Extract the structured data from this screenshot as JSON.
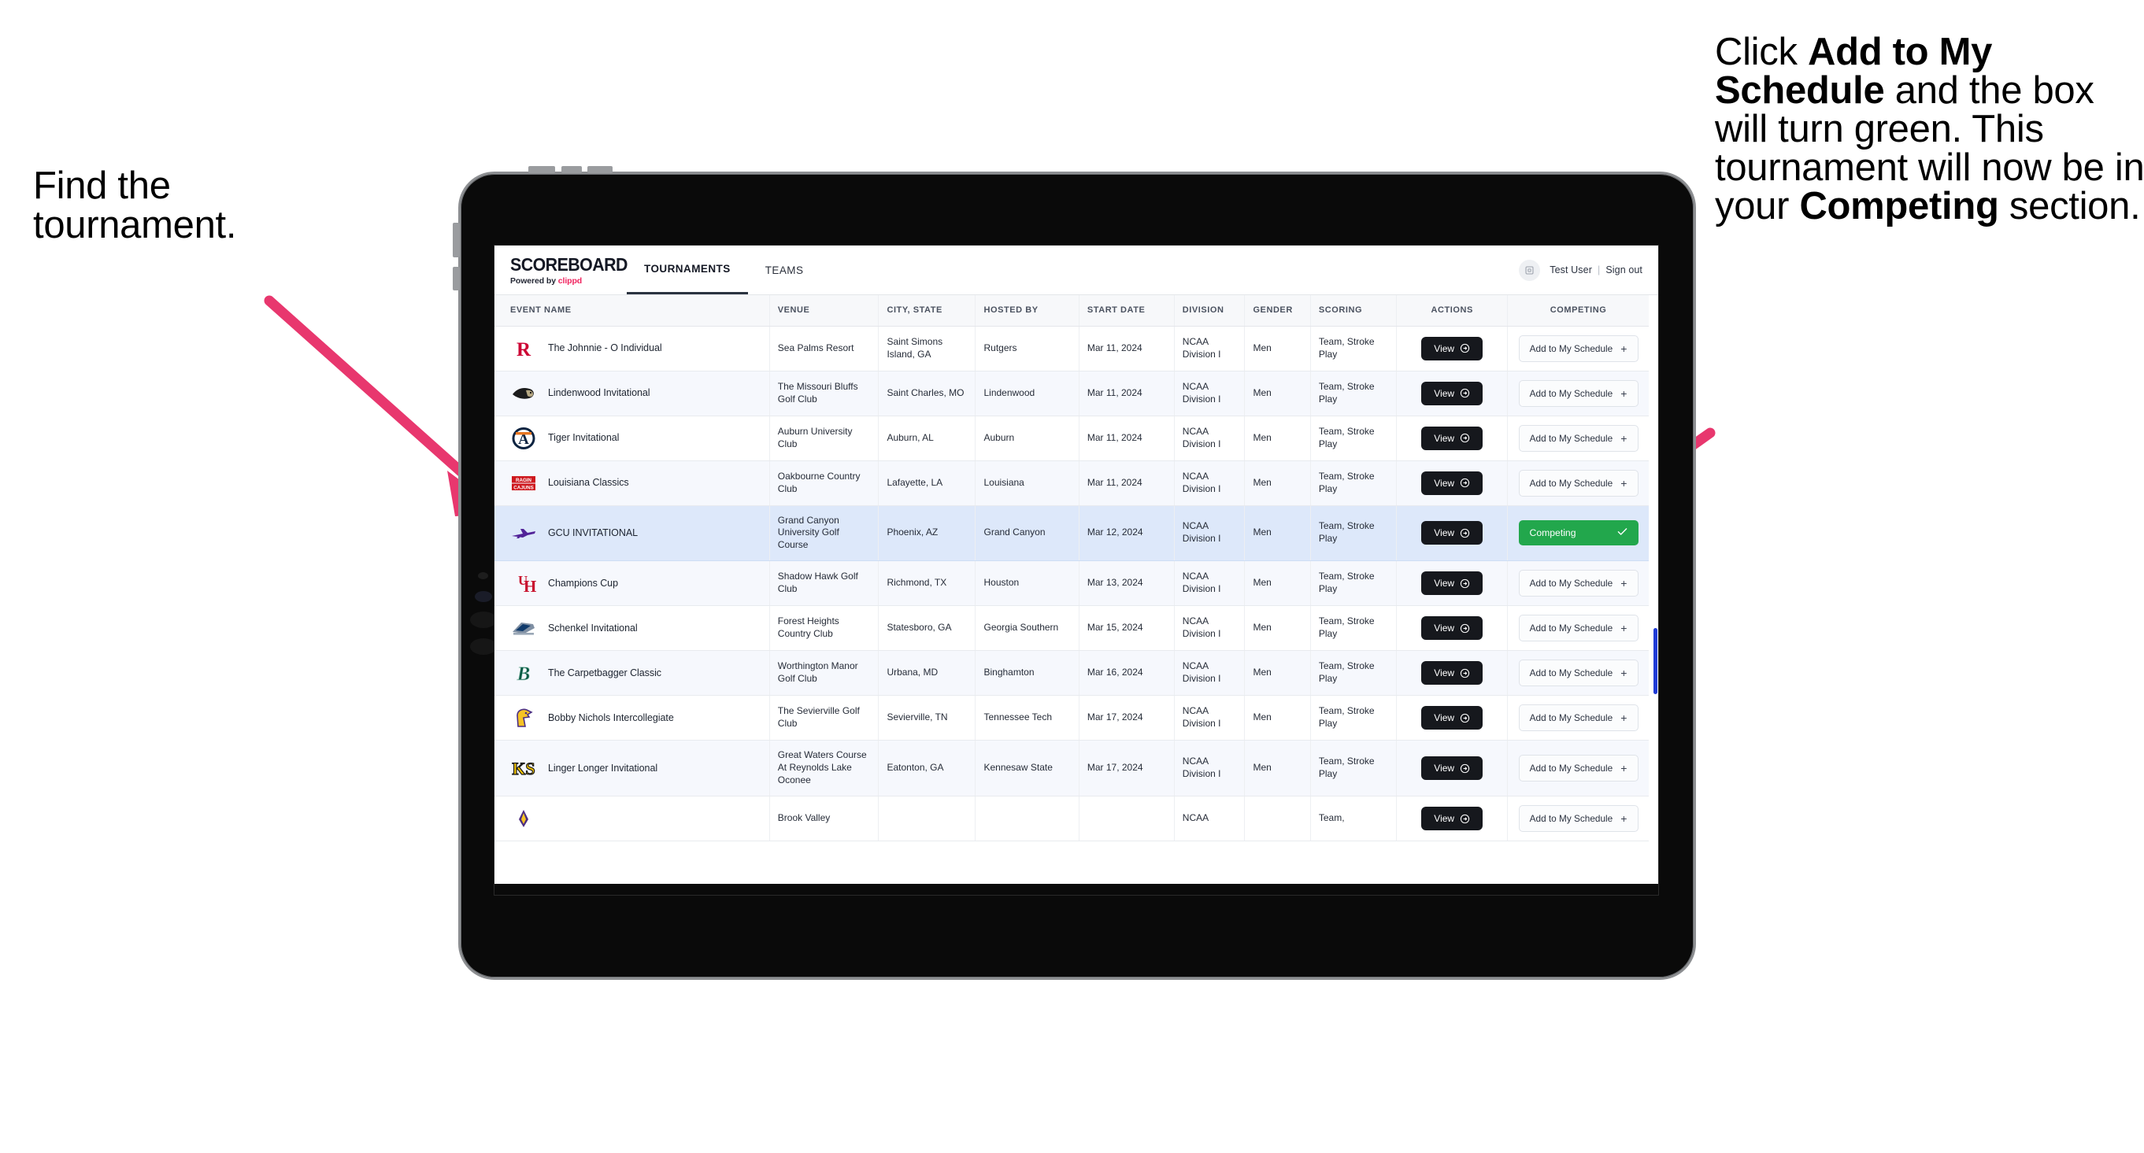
{
  "annotations": {
    "left": "Find the tournament.",
    "right_parts": [
      {
        "text": "Click ",
        "bold": false
      },
      {
        "text": "Add to My Schedule",
        "bold": true
      },
      {
        "text": " and the box will turn green. This tournament will now be in your ",
        "bold": false
      },
      {
        "text": "Competing",
        "bold": true
      },
      {
        "text": " section.",
        "bold": false
      }
    ],
    "arrow_color": "#e8376e"
  },
  "app": {
    "logo": {
      "wordmark": "SCOREBOARD",
      "powered_prefix": "Powered by ",
      "powered_brand": "clippd"
    },
    "nav": [
      {
        "label": "TOURNAMENTS",
        "active": true
      },
      {
        "label": "TEAMS",
        "active": false
      }
    ],
    "user": {
      "avatar_icon": "user-avatar-icon",
      "name": "Test User",
      "separator": "|",
      "signout": "Sign out"
    }
  },
  "table": {
    "columns": [
      "EVENT NAME",
      "VENUE",
      "CITY, STATE",
      "HOSTED BY",
      "START DATE",
      "DIVISION",
      "GENDER",
      "SCORING",
      "ACTIONS",
      "COMPETING"
    ],
    "action_label": "View",
    "add_label": "Add to My Schedule",
    "add_plus": "+",
    "competing_label": "Competing",
    "competing_check": "✓",
    "rows": [
      {
        "logo": "rutgers-logo",
        "event": "The Johnnie - O Individual",
        "venue": "Sea Palms Resort",
        "city": "Saint Simons Island, GA",
        "host": "Rutgers",
        "date": "Mar 11, 2024",
        "division": "NCAA Division I",
        "gender": "Men",
        "scoring": "Team, Stroke Play",
        "competing": false
      },
      {
        "logo": "lindenwood-logo",
        "event": "Lindenwood Invitational",
        "venue": "The Missouri Bluffs Golf Club",
        "city": "Saint Charles, MO",
        "host": "Lindenwood",
        "date": "Mar 11, 2024",
        "division": "NCAA Division I",
        "gender": "Men",
        "scoring": "Team, Stroke Play",
        "competing": false
      },
      {
        "logo": "auburn-logo",
        "event": "Tiger Invitational",
        "venue": "Auburn University Club",
        "city": "Auburn, AL",
        "host": "Auburn",
        "date": "Mar 11, 2024",
        "division": "NCAA Division I",
        "gender": "Men",
        "scoring": "Team, Stroke Play",
        "competing": false
      },
      {
        "logo": "louisiana-logo",
        "event": "Louisiana Classics",
        "venue": "Oakbourne Country Club",
        "city": "Lafayette, LA",
        "host": "Louisiana",
        "date": "Mar 11, 2024",
        "division": "NCAA Division I",
        "gender": "Men",
        "scoring": "Team, Stroke Play",
        "competing": false
      },
      {
        "logo": "gcu-logo",
        "event": "GCU INVITATIONAL",
        "venue": "Grand Canyon University Golf Course",
        "city": "Phoenix, AZ",
        "host": "Grand Canyon",
        "date": "Mar 12, 2024",
        "division": "NCAA Division I",
        "gender": "Men",
        "scoring": "Team, Stroke Play",
        "competing": true
      },
      {
        "logo": "houston-logo",
        "event": "Champions Cup",
        "venue": "Shadow Hawk Golf Club",
        "city": "Richmond, TX",
        "host": "Houston",
        "date": "Mar 13, 2024",
        "division": "NCAA Division I",
        "gender": "Men",
        "scoring": "Team, Stroke Play",
        "competing": false
      },
      {
        "logo": "georgia-southern-logo",
        "event": "Schenkel Invitational",
        "venue": "Forest Heights Country Club",
        "city": "Statesboro, GA",
        "host": "Georgia Southern",
        "date": "Mar 15, 2024",
        "division": "NCAA Division I",
        "gender": "Men",
        "scoring": "Team, Stroke Play",
        "competing": false
      },
      {
        "logo": "binghamton-logo",
        "event": "The Carpetbagger Classic",
        "venue": "Worthington Manor Golf Club",
        "city": "Urbana, MD",
        "host": "Binghamton",
        "date": "Mar 16, 2024",
        "division": "NCAA Division I",
        "gender": "Men",
        "scoring": "Team, Stroke Play",
        "competing": false
      },
      {
        "logo": "tennessee-tech-logo",
        "event": "Bobby Nichols Intercollegiate",
        "venue": "The Sevierville Golf Club",
        "city": "Sevierville, TN",
        "host": "Tennessee Tech",
        "date": "Mar 17, 2024",
        "division": "NCAA Division I",
        "gender": "Men",
        "scoring": "Team, Stroke Play",
        "competing": false
      },
      {
        "logo": "kennesaw-state-logo",
        "event": "Linger Longer Invitational",
        "venue": "Great Waters Course At Reynolds Lake Oconee",
        "city": "Eatonton, GA",
        "host": "Kennesaw State",
        "date": "Mar 17, 2024",
        "division": "NCAA Division I",
        "gender": "Men",
        "scoring": "Team, Stroke Play",
        "competing": false
      },
      {
        "logo": "partial-logo",
        "event": "",
        "venue": "Brook Valley",
        "city": "",
        "host": "",
        "date": "",
        "division": "NCAA",
        "gender": "",
        "scoring": "Team,",
        "competing": false
      }
    ]
  },
  "colors": {
    "accent_pink": "#e8376e",
    "competing_green": "#22a74c",
    "selected_row": "#dde8fa",
    "alt_row": "#f6f8fd",
    "dark_button": "#16181d",
    "brand_pink": "#f0245f"
  }
}
